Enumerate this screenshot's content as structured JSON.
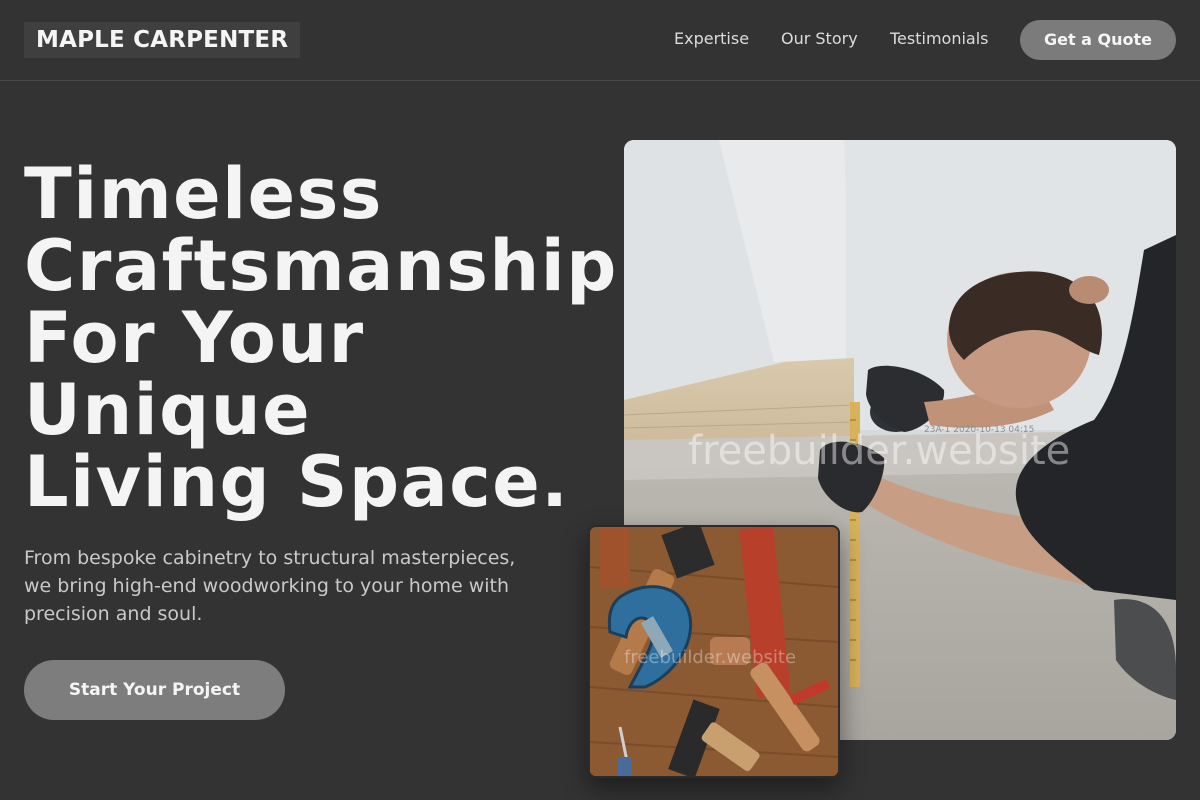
{
  "header": {
    "logo": "MAPLE CARPENTER",
    "nav": [
      "Expertise",
      "Our Story",
      "Testimonials"
    ],
    "cta_label": "Get a Quote"
  },
  "hero": {
    "title": "Timeless\nCraftsmanship\nFor Your\nUnique\nLiving Space.",
    "subtitle": "From bespoke cabinetry to structural masterpieces, we bring high-end woodworking to your home with precision and soul.",
    "cta_label": "Start Your Project"
  },
  "images": {
    "main": {
      "watermark": "freebuilder.website"
    },
    "secondary": {
      "watermark": "freebuilder.website"
    }
  },
  "colors": {
    "background": "#333333",
    "button": "#7b7b7b",
    "text": "#f4f4f4"
  }
}
